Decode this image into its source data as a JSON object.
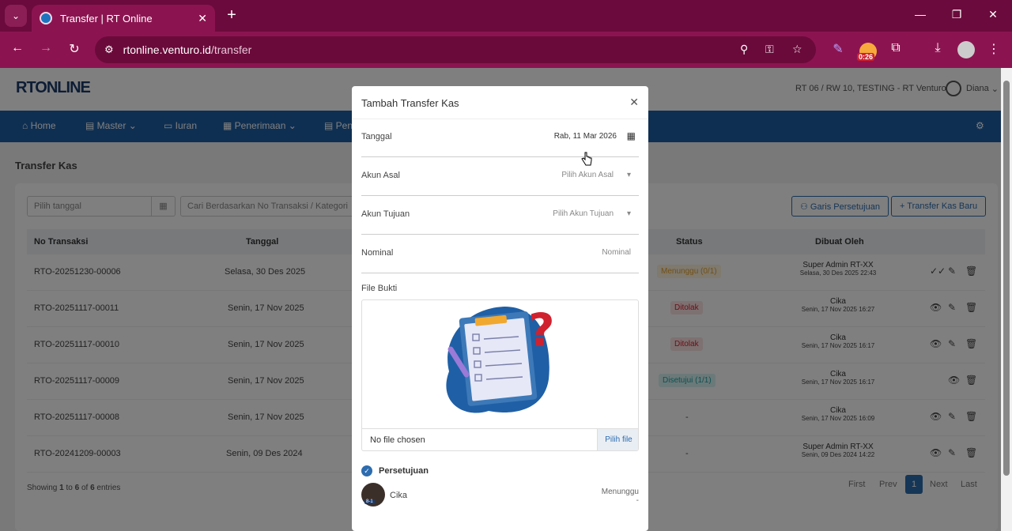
{
  "browser": {
    "tab_title": "Transfer | RT Online",
    "url_host": "rtonline.venturo.id",
    "url_path": "/transfer",
    "timer_label": "0:26"
  },
  "header": {
    "logo": "RTONLINE",
    "rt_info": "RT 06 / RW 10, TESTING - RT Venturo",
    "user_name": "Diana"
  },
  "menu": [
    "Home",
    "Master",
    "Iuran",
    "Penerimaan",
    "Pen"
  ],
  "page": {
    "title": "Transfer Kas",
    "date_placeholder": "Pilih tanggal",
    "search_placeholder": "Cari Berdasarkan No Transaksi / Kategori",
    "btn_approval": "Garis Persetujuan",
    "btn_new": "Transfer Kas Baru"
  },
  "table": {
    "headers": {
      "no": "No Transaksi",
      "date": "Tanggal",
      "status": "Status",
      "by": "Dibuat Oleh"
    },
    "rows": [
      {
        "no": "RTO-20251230-00006",
        "date": "Selasa, 30 Des 2025",
        "status": "Menunggu (0/1)",
        "by": "Super Admin RT-XX",
        "by_date": "Selasa, 30 Des 2025 22:43"
      },
      {
        "no": "RTO-20251117-00011",
        "date": "Senin, 17 Nov 2025",
        "status": "Ditolak",
        "by": "Cika",
        "by_date": "Senin, 17 Nov 2025 16:27"
      },
      {
        "no": "RTO-20251117-00010",
        "date": "Senin, 17 Nov 2025",
        "status": "Ditolak",
        "by": "Cika",
        "by_date": "Senin, 17 Nov 2025 16:17"
      },
      {
        "no": "RTO-20251117-00009",
        "date": "Senin, 17 Nov 2025",
        "status": "Disetujui (1/1)",
        "by": "Cika",
        "by_date": "Senin, 17 Nov 2025 16:17"
      },
      {
        "no": "RTO-20251117-00008",
        "date": "Senin, 17 Nov 2025",
        "status": "-",
        "by": "Cika",
        "by_date": "Senin, 17 Nov 2025 16:09"
      },
      {
        "no": "RTO-20241209-00003",
        "date": "Senin, 09 Des 2024",
        "status": "-",
        "by": "Super Admin RT-XX",
        "by_date": "Senin, 09 Des 2024 14:22"
      }
    ],
    "footer_pre": "Showing ",
    "footer_from": "1",
    "footer_mid1": " to ",
    "footer_to": "6",
    "footer_mid2": " of ",
    "footer_total": "6",
    "footer_post": " entries",
    "pagination": {
      "first": "First",
      "prev": "Prev",
      "current": "1",
      "next": "Next",
      "last": "Last"
    }
  },
  "modal": {
    "title": "Tambah Transfer Kas",
    "tanggal_label": "Tanggal",
    "tanggal_value": "Rab, 11 Mar 2026",
    "asal_label": "Akun Asal",
    "asal_placeholder": "Pilih Akun Asal",
    "tujuan_label": "Akun Tujuan",
    "tujuan_placeholder": "Pilih Akun Tujuan",
    "nominal_label": "Nominal",
    "nominal_placeholder": "Nominal",
    "file_label": "File Bukti",
    "file_status": "No file chosen",
    "file_button": "Pilih file",
    "approval_label": "Persetujuan",
    "approver_name": "Cika",
    "approver_badge": "8-1",
    "approver_status": "Menunggu",
    "approver_status2": "-"
  },
  "colors": {
    "brand": "#1f5fa5",
    "browser": "#8b1450",
    "danger": "#d0212f",
    "warning": "#e0a030",
    "success": "#1aa3a3"
  }
}
